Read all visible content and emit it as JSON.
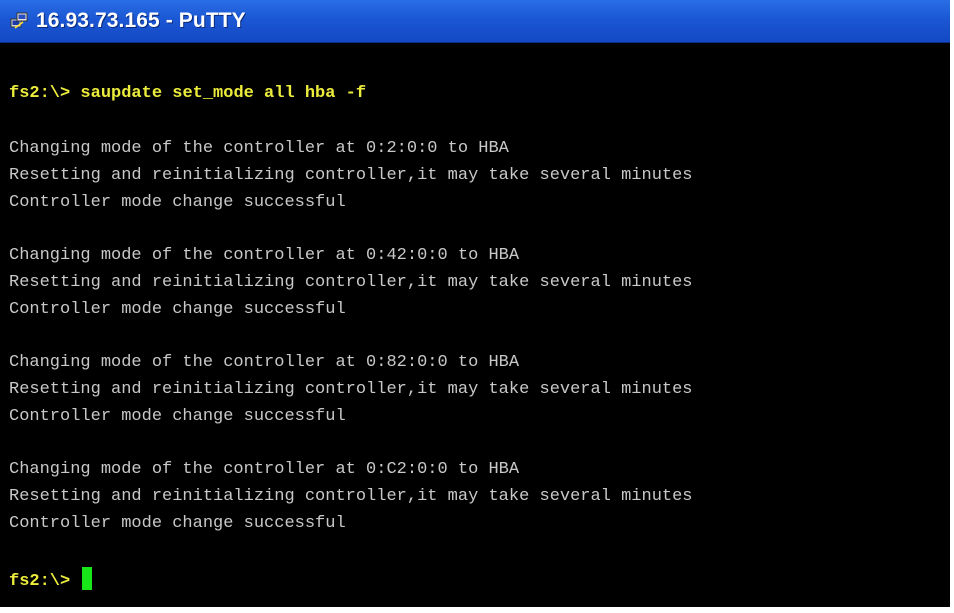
{
  "window": {
    "title": "16.93.73.165 - PuTTY",
    "icon": "putty-icon"
  },
  "terminal": {
    "command_line": {
      "prompt": "fs2:\\>",
      "command": "saupdate set_mode all hba -f"
    },
    "blocks": [
      {
        "changing": "Changing mode of the controller at 0:2:0:0 to HBA",
        "resetting": "Resetting and reinitializing controller,it may take several minutes",
        "result": "Controller mode change successful"
      },
      {
        "changing": "Changing mode of the controller at 0:42:0:0 to HBA",
        "resetting": "Resetting and reinitializing controller,it may take several minutes",
        "result": "Controller mode change successful"
      },
      {
        "changing": "Changing mode of the controller at 0:82:0:0 to HBA",
        "resetting": "Resetting and reinitializing controller,it may take several minutes",
        "result": "Controller mode change successful"
      },
      {
        "changing": "Changing mode of the controller at 0:C2:0:0 to HBA",
        "resetting": "Resetting and reinitializing controller,it may take several minutes",
        "result": "Controller mode change successful"
      }
    ],
    "final_prompt": "fs2:\\>",
    "colors": {
      "background": "#000000",
      "output_text": "#c8c8c8",
      "prompt_text": "#ecec3c",
      "cursor": "#19e619",
      "titlebar": "#1b57d4"
    }
  }
}
